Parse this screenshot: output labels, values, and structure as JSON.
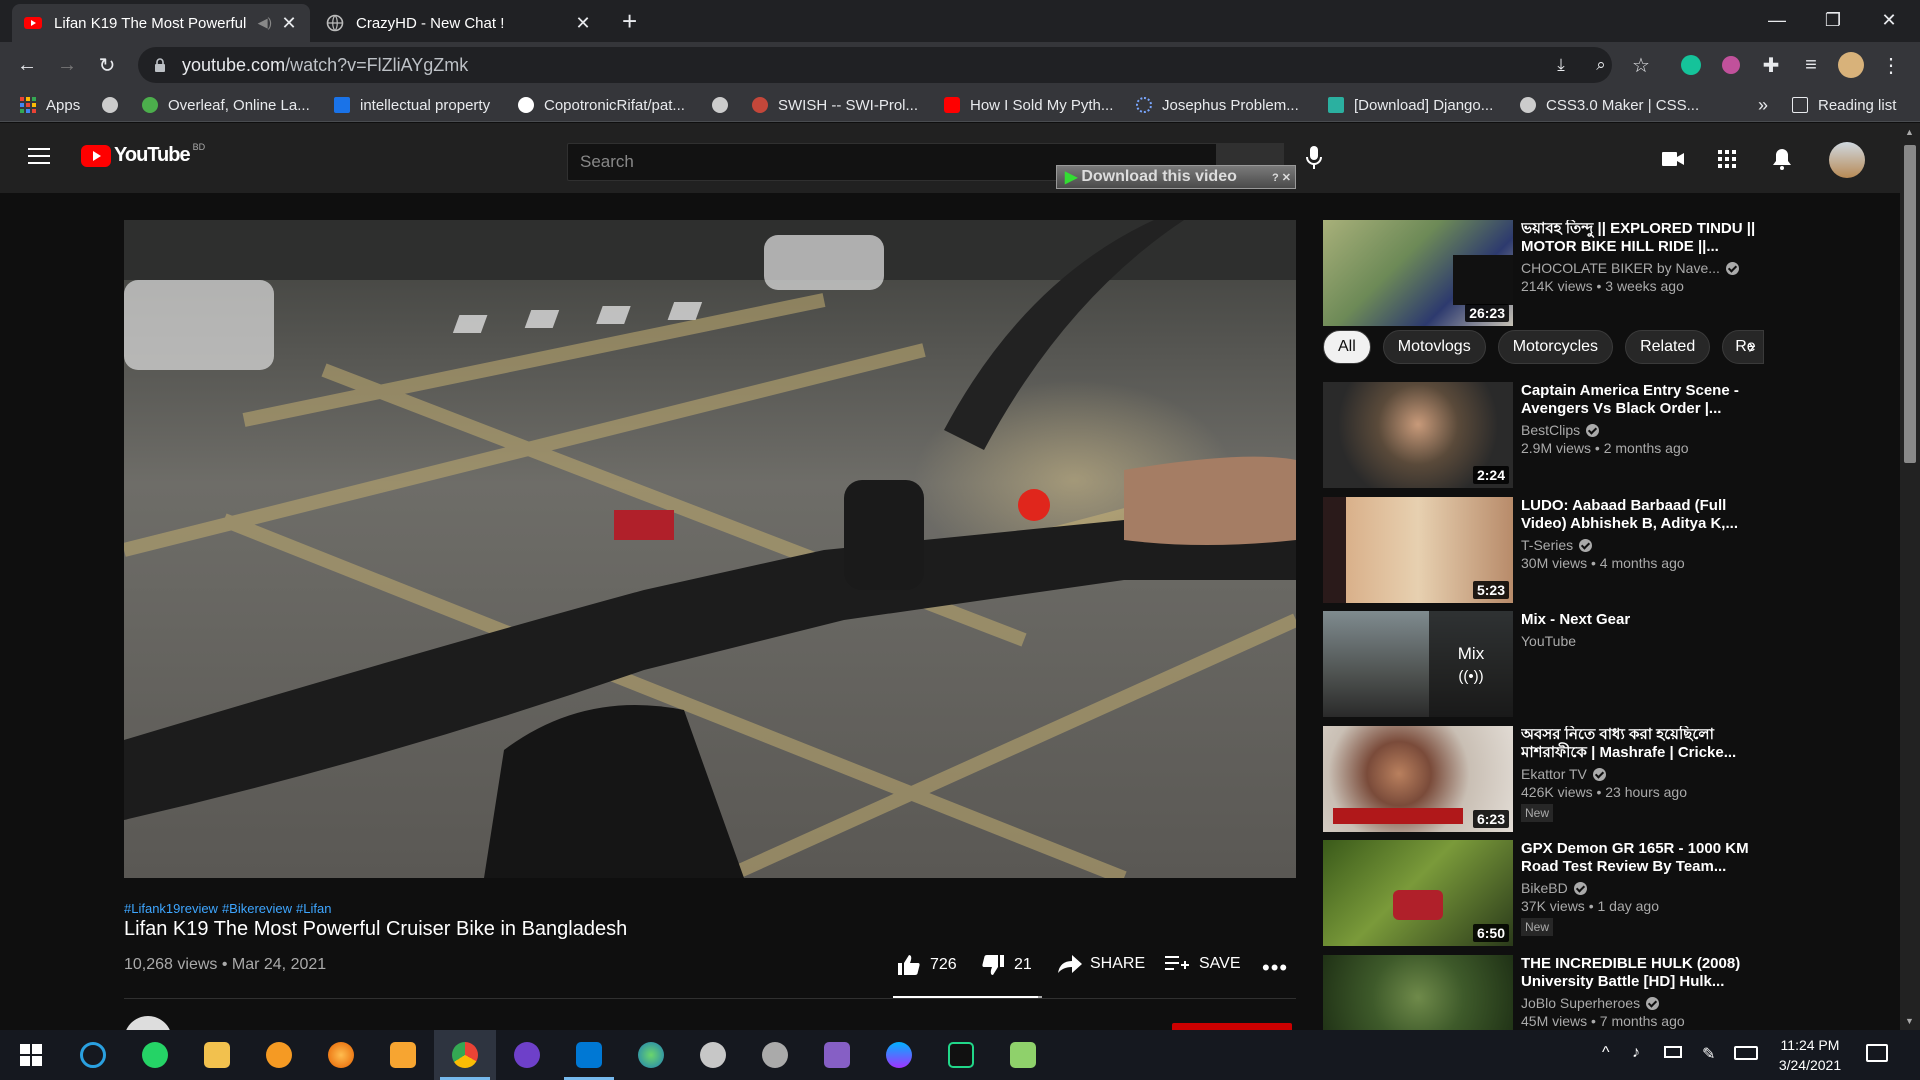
{
  "browser": {
    "tabs": [
      {
        "title": "Lifan K19 The Most Powerful",
        "active": true
      },
      {
        "title": "CrazyHD - New Chat !",
        "active": false
      }
    ],
    "url_domain": "youtube.com",
    "url_path": "/watch?v=FlZliAYgZmk",
    "bookmarks": [
      {
        "label": "Apps"
      },
      {
        "label": ""
      },
      {
        "label": "Overleaf, Online La..."
      },
      {
        "label": "intellectual property"
      },
      {
        "label": "CopotronicRifat/pat..."
      },
      {
        "label": ""
      },
      {
        "label": "SWISH -- SWI-Prol..."
      },
      {
        "label": "How I Sold My Pyth..."
      },
      {
        "label": "Josephus Problem..."
      },
      {
        "label": "[Download] Django..."
      },
      {
        "label": "CSS3.0 Maker | CSS..."
      }
    ],
    "overflow_label": "»",
    "reading_list": "Reading list"
  },
  "youtube": {
    "logo_text": "YouTube",
    "country_code": "BD",
    "search_placeholder": "Search",
    "download_banner": "Download this video",
    "video": {
      "hashtags": [
        "#Lifank19review",
        "#Bikereview",
        "#Lifan"
      ],
      "title": "Lifan K19 The Most Powerful Cruiser Bike in Bangladesh",
      "meta": "10,268 views • Mar 24, 2021",
      "likes": "726",
      "dislikes": "21",
      "like_ratio": 0.972,
      "share_label": "SHARE",
      "save_label": "SAVE"
    },
    "chips": [
      "All",
      "Motovlogs",
      "Motorcycles",
      "Related",
      "Re"
    ],
    "recommendations": [
      {
        "title": "ভয়াবহ তিন্দু || EXPLORED TINDU || MOTOR BIKE HILL RIDE ||...",
        "channel": "CHOCOLATE BIKER by Nave...",
        "verified": true,
        "views": "214K views • 3 weeks ago",
        "duration": "26:23",
        "new": false
      },
      {
        "title": "Captain America Entry Scene - Avengers Vs Black Order |...",
        "channel": "BestClips",
        "verified": true,
        "views": "2.9M views • 2 months ago",
        "duration": "2:24",
        "new": false
      },
      {
        "title": "LUDO: Aabaad Barbaad (Full Video) Abhishek B, Aditya K,...",
        "channel": "T-Series",
        "verified": true,
        "views": "30M views • 4 months ago",
        "duration": "5:23",
        "new": false
      },
      {
        "title": "Mix - Next Gear",
        "channel": "YouTube",
        "verified": false,
        "views": "",
        "duration": "",
        "mix_label": "Mix",
        "new": false
      },
      {
        "title": "অবসর নিতে বাধ্য করা হয়েছিলো মাশরাফীকে | Mashrafe | Cricke...",
        "channel": "Ekattor TV",
        "verified": true,
        "views": "426K views • 23 hours ago",
        "duration": "6:23",
        "new": true
      },
      {
        "title": "GPX Demon GR 165R - 1000 KM Road Test Review By Team...",
        "channel": "BikeBD",
        "verified": true,
        "views": "37K views • 1 day ago",
        "duration": "6:50",
        "new": true
      },
      {
        "title": "THE INCREDIBLE HULK (2008) University Battle [HD] Hulk...",
        "channel": "JoBlo Superheroes",
        "verified": true,
        "views": "45M views • 7 months ago",
        "duration": "",
        "new": false
      }
    ],
    "new_badge": "New"
  },
  "taskbar": {
    "time": "11:24 PM",
    "date": "3/24/2021"
  },
  "colors": {
    "accent": "#3ea6ff",
    "youtube_red": "#ff0000",
    "background": "#0f0f0f"
  }
}
